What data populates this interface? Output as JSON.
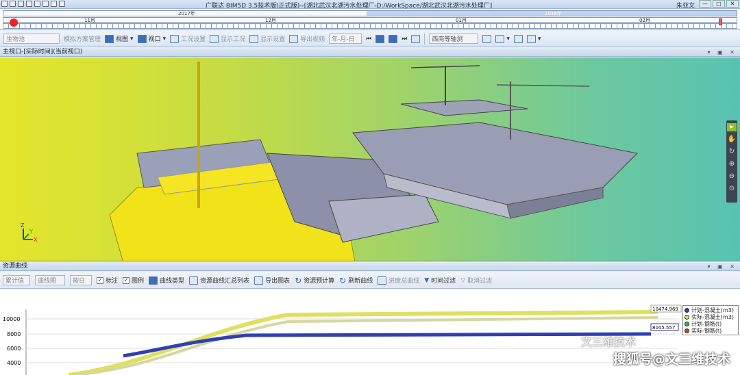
{
  "app": {
    "title": "广联达 BIM5D 3.5技术版(正式版)--[湖北武汉北湖污水处理厂-D:/WorkSpace/湖北武汉北湖污水处理厂]",
    "user": "朱亚文"
  },
  "timeline": {
    "year": "2017年",
    "year2": "2018年",
    "months": [
      "11月",
      "12月",
      "01月",
      "02月"
    ]
  },
  "toolbar": {
    "combo_entity": "生物池",
    "simulate_plan": "模拟方案管理",
    "view": "视图",
    "viewport": "视口",
    "work_setting": "工况设置",
    "show_work": "显示工况",
    "display_setting": "显示设置",
    "export_video": "导出视频",
    "date_format": "年-月-日",
    "view_preset": "西南等轴测"
  },
  "viewport_panel": {
    "title": "主视口-[实际时间](当前视口)",
    "axis_z": "Z",
    "axis_y": "Y",
    "axis_x": "X"
  },
  "resource_panel": {
    "title": "资源曲线",
    "combo_accum": "累计值",
    "combo_chart": "曲线图",
    "combo_unit": "按日",
    "chk_label": "标注",
    "chk_legend": "图例",
    "curve_type": "曲线类型",
    "summary_list": "资源曲线汇总列表",
    "export_chart": "导出图表",
    "resource_estimate": "资源预计算",
    "refresh_curve": "刷新曲线",
    "progress_curve": "进度总曲线",
    "time_filter": "时间过滤",
    "cancel_filter": "取消过滤"
  },
  "chart_data": {
    "type": "line",
    "yticks": [
      "10000",
      "8000",
      "6000",
      "4000"
    ],
    "series": [
      {
        "name": "计划-混凝土(m3)",
        "color": "#2f3fb5",
        "end_label": ""
      },
      {
        "name": "实际-混凝土(m3)",
        "color": "#e0e060",
        "end_label": "10474.969"
      },
      {
        "name": "计划-钢筋(t)",
        "color": "#3fae3f",
        "end_label": ""
      },
      {
        "name": "实际-钢筋(t)",
        "color": "#d23c2c",
        "end_label": ""
      }
    ],
    "plan_concrete_end": "8045.557"
  },
  "watermark": {
    "line1": "文三维技术",
    "line2": "搜狐号@文三维技术"
  }
}
